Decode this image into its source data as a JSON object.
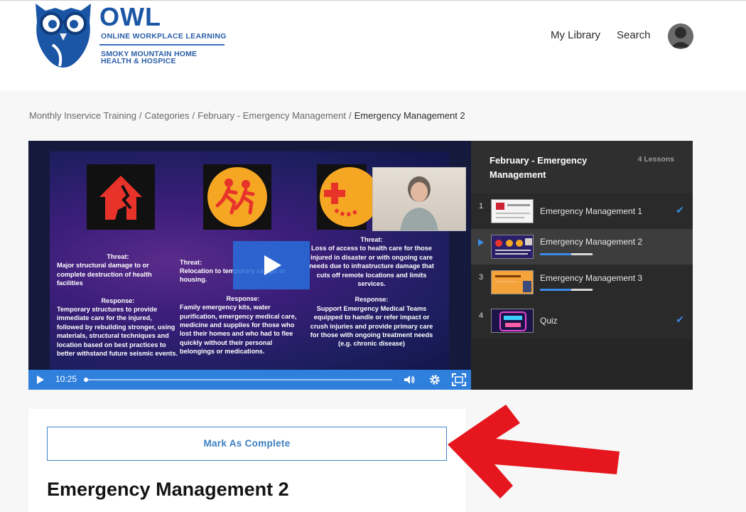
{
  "header": {
    "logo": {
      "title": "OWL",
      "subtitle": "ONLINE WORKPLACE LEARNING",
      "org": "SMOKY MOUNTAIN HOME HEALTH & HOSPICE"
    },
    "nav": [
      {
        "label": "My Library"
      },
      {
        "label": "Search"
      }
    ]
  },
  "breadcrumb": [
    "Monthly Inservice Training",
    "Categories",
    "February - Emergency Management",
    "Emergency Management 2"
  ],
  "breadcrumb_separator": "/",
  "video": {
    "time": "10:25",
    "progress_fraction": 0.0,
    "slide": {
      "col1": {
        "threat_head": "Threat:",
        "threat": "Major structural damage to or complete destruction of health facilities",
        "response_head": "Response:",
        "response": "Temporary structures to provide immediate care for the injured, followed by rebuilding stronger, using materials, structural techniques and location based on best practices to better withstand future seismic events."
      },
      "col2": {
        "threat_head": "Threat:",
        "threat": "Relocation to temporary camps or housing.",
        "response_head": "Response:",
        "response": "Family emergency kits, water purification, emergency medical care, medicine and supplies for those who lost their homes and who had to flee quickly without their personal belongings or medications."
      },
      "col3": {
        "threat_head": "Threat:",
        "threat": "Loss of access to health care for those injured in disaster or with ongoing care needs due to infrastructure damage that cuts off remote locations and limits services.",
        "response_head": "Response:",
        "response": "Support Emergency Medical Teams equipped to handle or refer impact or crush injuries and provide primary care for those with ongoing treatment needs (e.g. chronic disease)"
      }
    }
  },
  "panel": {
    "title": "February - Emergency Management",
    "count": "4 Lessons",
    "lessons": [
      {
        "num": "1",
        "title": "Emergency Management 1",
        "completed": true,
        "progress": null
      },
      {
        "num": "",
        "title": "Emergency Management 2",
        "completed": false,
        "progress": 0.6,
        "current": true
      },
      {
        "num": "3",
        "title": "Emergency Management 3",
        "completed": false,
        "progress": 0.6
      },
      {
        "num": "4",
        "title": "Quiz",
        "completed": true,
        "progress": null
      }
    ],
    "check_glyph": "✔"
  },
  "content": {
    "complete_button": "Mark As Complete",
    "heading": "Emergency Management 2"
  },
  "colors": {
    "accent": "#3b8be8",
    "brand": "#1b56a6",
    "annotation": "#e5161d"
  },
  "icons": {
    "avatar": "user-avatar-icon",
    "play": "play-icon",
    "volume": "volume-icon",
    "settings": "gear-icon",
    "fullscreen": "fullscreen-icon",
    "check": "checkmark-icon"
  }
}
